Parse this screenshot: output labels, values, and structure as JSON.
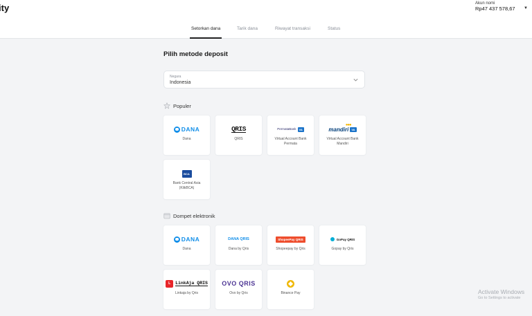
{
  "header": {
    "brand": "ity",
    "account_label": "Akun nomi",
    "balance": "Rp47 437 578,67"
  },
  "tabs": [
    {
      "label": "Setorkan dana",
      "active": true
    },
    {
      "label": "Tarik dana",
      "active": false
    },
    {
      "label": "Riwayat transaksi",
      "active": false
    },
    {
      "label": "Status",
      "active": false
    }
  ],
  "page": {
    "title": "Pilih metode deposit",
    "country_label": "Negara",
    "country_value": "Indonesia"
  },
  "sections": {
    "popular": "Populer",
    "ewallet": "Dompet elektronik"
  },
  "popular_methods": [
    {
      "label": "Dana",
      "logo": "DANA"
    },
    {
      "label": "QRIS",
      "logo": "QRIS"
    },
    {
      "label": "Virtual Account Bank Permata",
      "logo": "PermataBank",
      "badge": "VA"
    },
    {
      "label": "Virtual Account Bank Mandiri",
      "logo": "mandiri",
      "badge": "VA"
    },
    {
      "label": "Bank Central Asia (KlikBCA)",
      "logo": "BCA"
    }
  ],
  "ewallet_methods": [
    {
      "label": "Dana",
      "logo": "DANA"
    },
    {
      "label": "Dana by Qris",
      "logo": "DANA QRIS"
    },
    {
      "label": "Shopeepay by Qris",
      "logo": "ShopeePay QRIS"
    },
    {
      "label": "Gopay by Qris",
      "logo": "GoPay QRIS"
    },
    {
      "label": "Linkaja by Qris",
      "logo": "LinkAja QRIS"
    },
    {
      "label": "Ovo by Qris",
      "logo": "OVO QRIS"
    },
    {
      "label": "Binance Pay",
      "logo": "Binance"
    }
  ],
  "windows_watermark": {
    "title": "Activate Windows",
    "subtitle": "Go to Settings to activate"
  },
  "colors": {
    "dana_blue": "#108ee9",
    "shopee_orange": "#ee4d2d",
    "ovo_purple": "#4c3494",
    "binance_yellow": "#f0b90b",
    "linkaja_red": "#e82529"
  }
}
